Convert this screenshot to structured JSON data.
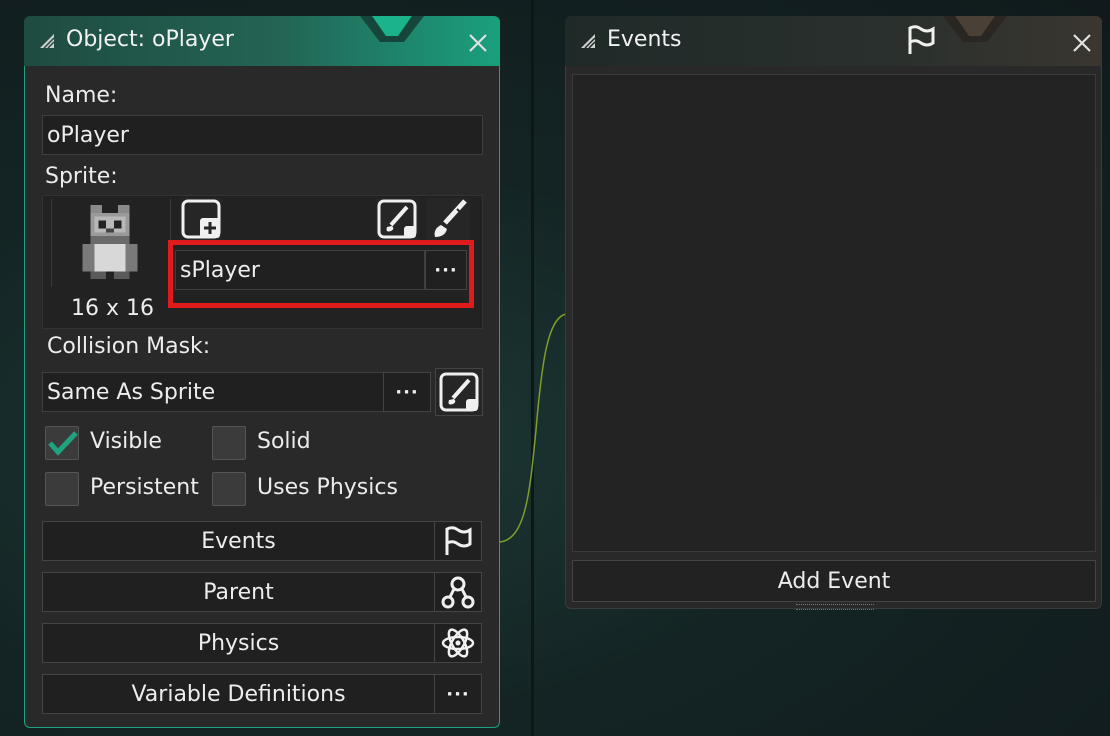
{
  "object_panel": {
    "title": "Object: oPlayer",
    "name_label": "Name:",
    "name_value": "oPlayer",
    "sprite_label": "Sprite:",
    "sprite_name": "sPlayer",
    "sprite_size": "16 x 16",
    "collision_label": "Collision Mask:",
    "collision_value": "Same As Sprite",
    "checkboxes": [
      {
        "label": "Visible",
        "checked": true
      },
      {
        "label": "Solid",
        "checked": false
      },
      {
        "label": "Persistent",
        "checked": false
      },
      {
        "label": "Uses Physics",
        "checked": false
      }
    ],
    "buttons": {
      "events": "Events",
      "parent": "Parent",
      "physics": "Physics",
      "variables": "Variable Definitions"
    },
    "more_glyph": "···"
  },
  "events_panel": {
    "title": "Events",
    "add_event": "Add Event"
  },
  "icons": [
    "grip-icon",
    "close-icon",
    "add-sprite-icon",
    "edit-sprite-icon",
    "brush-icon",
    "more-icon",
    "flag-icon",
    "parent-icon",
    "atom-icon",
    "checkmark-icon"
  ],
  "colors": {
    "accent_green": "#1ea380",
    "highlight_red": "#e01b1b",
    "panel_bg": "#292929"
  }
}
